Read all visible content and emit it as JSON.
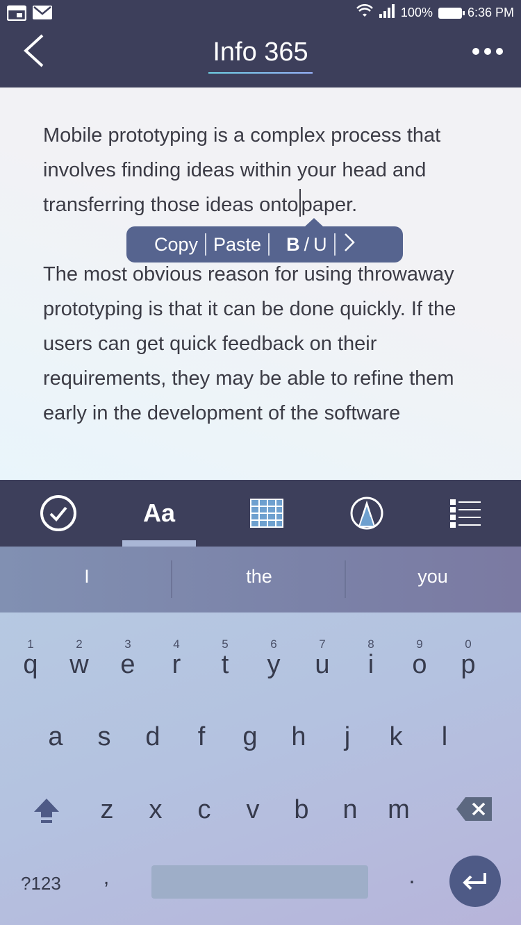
{
  "status": {
    "battery": "100%",
    "time": "6:36 PM"
  },
  "header": {
    "title": "Info 365"
  },
  "content": {
    "para1_before_cursor": "Mobile prototyping is a complex process that involves finding ideas within your head and transferring those ideas onto",
    "para1_after_cursor": "paper.",
    "para2": "The most obvious reason for using throwaway prototyping is that it can be done quickly. If the users can get quick feedback on their requirements, they may be able to refine them early in the development of the software"
  },
  "popup": {
    "copy": "Copy",
    "paste": "Paste",
    "bold": "B",
    "slash": "/",
    "underline": "U"
  },
  "toolbar": {
    "aa_label": "Aa",
    "icons": [
      "check-circle-icon",
      "text-format-icon",
      "table-icon",
      "pen-icon",
      "list-icon"
    ],
    "selected": "Aa"
  },
  "keyboard": {
    "suggestions": [
      "I",
      "the",
      "you"
    ],
    "row1": [
      {
        "num": "1",
        "letter": "q"
      },
      {
        "num": "2",
        "letter": "w"
      },
      {
        "num": "3",
        "letter": "e"
      },
      {
        "num": "4",
        "letter": "r"
      },
      {
        "num": "5",
        "letter": "t"
      },
      {
        "num": "6",
        "letter": "y"
      },
      {
        "num": "7",
        "letter": "u"
      },
      {
        "num": "8",
        "letter": "i"
      },
      {
        "num": "9",
        "letter": "o"
      },
      {
        "num": "0",
        "letter": "p"
      }
    ],
    "row2": [
      "a",
      "s",
      "d",
      "f",
      "g",
      "h",
      "j",
      "k",
      "l"
    ],
    "row3": [
      "z",
      "x",
      "c",
      "v",
      "b",
      "n",
      "m"
    ],
    "symbols_label": "?123",
    "comma": ",",
    "period": "."
  },
  "colors": {
    "header_bg": "#3d3f5b",
    "popup_bg": "#56648f",
    "enter_bg": "#4e5a86"
  }
}
